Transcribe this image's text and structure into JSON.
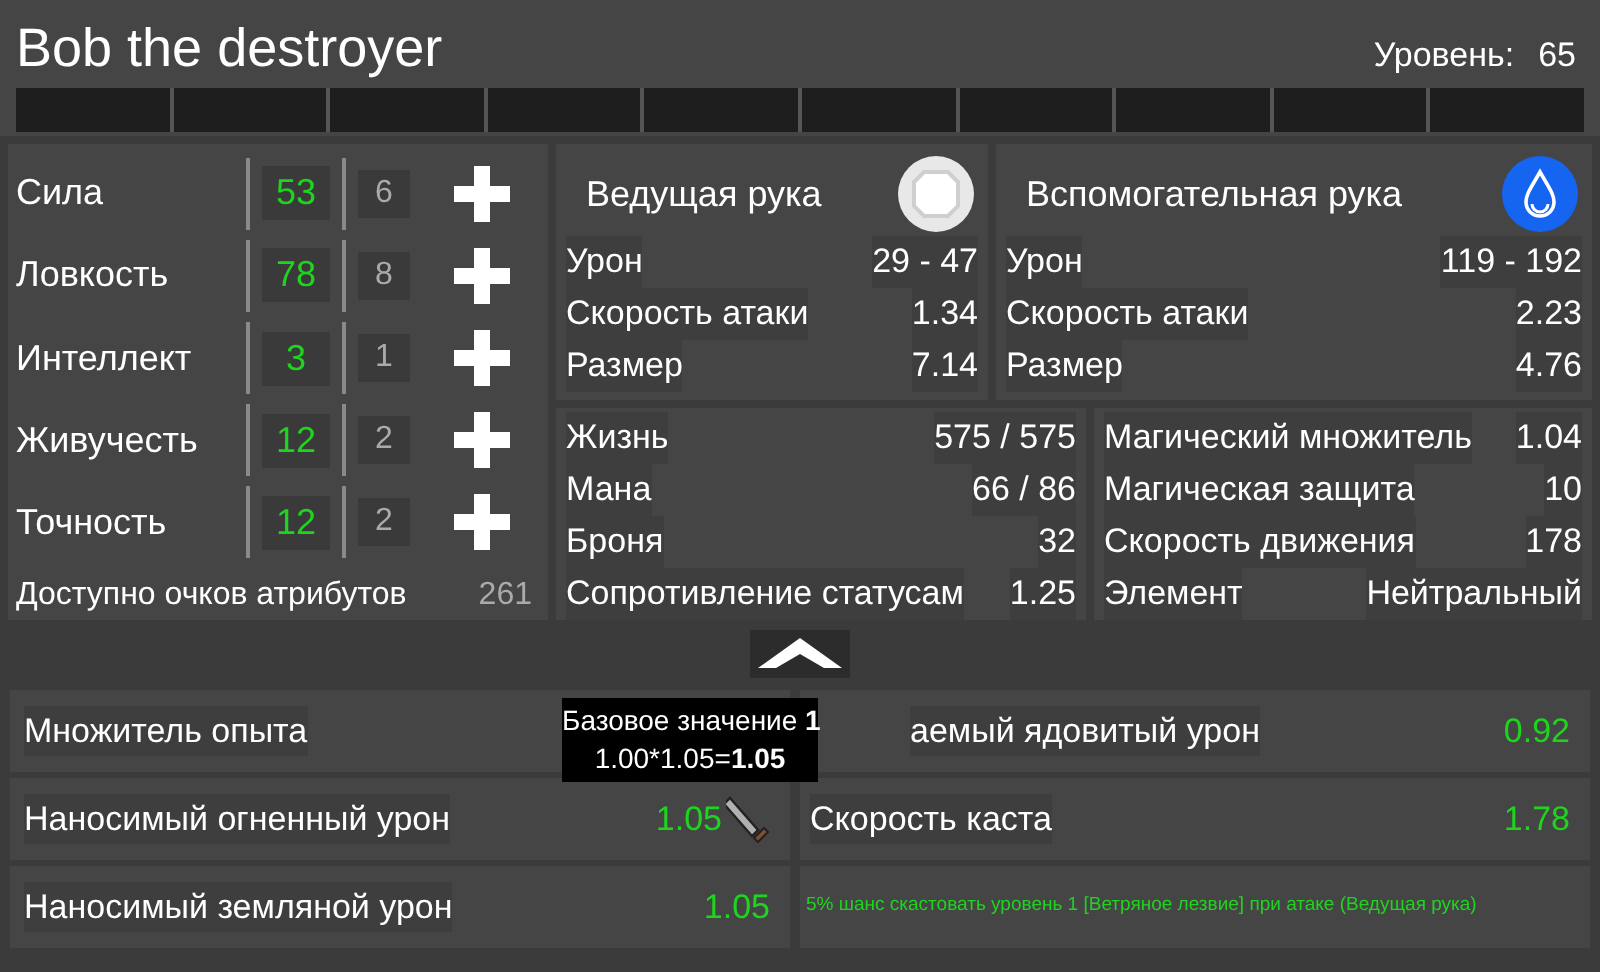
{
  "header": {
    "title": "Bob the destroyer",
    "level_label": "Уровень:",
    "level_value": "65"
  },
  "attributes": [
    {
      "name": "Сила",
      "value": "53",
      "points": "6"
    },
    {
      "name": "Ловкость",
      "value": "78",
      "points": "8"
    },
    {
      "name": "Интеллект",
      "value": "3",
      "points": "1"
    },
    {
      "name": "Живучесть",
      "value": "12",
      "points": "2"
    },
    {
      "name": "Точность",
      "value": "12",
      "points": "2"
    }
  ],
  "available": {
    "label": "Доступно очков атрибутов",
    "value": "261"
  },
  "hands": [
    {
      "title": "Ведущая рука",
      "kind": "neutral",
      "stats": [
        {
          "label": "Урон",
          "value": "29 - 47"
        },
        {
          "label": "Скорость атаки",
          "value": "1.34"
        },
        {
          "label": "Размер",
          "value": "7.14"
        }
      ]
    },
    {
      "title": "Вспомогательная рука",
      "kind": "water",
      "stats": [
        {
          "label": "Урон",
          "value": "119 - 192"
        },
        {
          "label": "Скорость атаки",
          "value": "2.23"
        },
        {
          "label": "Размер",
          "value": "4.76"
        }
      ]
    }
  ],
  "stats_left": [
    {
      "label": "Жизнь",
      "value": "575 / 575"
    },
    {
      "label": "Мана",
      "value": "66 / 86"
    },
    {
      "label": "Броня",
      "value": "32"
    },
    {
      "label": "Сопротивление статусам",
      "value": "1.25"
    }
  ],
  "stats_right": [
    {
      "label": "Магический множитель",
      "value": "1.04"
    },
    {
      "label": "Магическая защита",
      "value": "10"
    },
    {
      "label": "Скорость движения",
      "value": "178"
    },
    {
      "label": "Элемент",
      "value": "Нейтральный"
    }
  ],
  "bonuses_left": [
    {
      "label": "Множитель опыта"
    },
    {
      "label": "Наносимый огненный урон",
      "value": "1.05"
    },
    {
      "label": "Наносимый земляной урон",
      "value": "1.05"
    }
  ],
  "bonuses_right": [
    {
      "kind": "stat",
      "label": "аемый ядовитый урон",
      "value": "0.92"
    },
    {
      "kind": "stat",
      "label": "Скорость каста",
      "value": "1.78"
    },
    {
      "kind": "effect",
      "label": "5% шанс скастовать уровень 1 [Ветряное лезвие] при атаке (Ведущая рука)"
    }
  ],
  "tooltip": {
    "lines": [
      "Базовое значение **1**",
      "1.00*1.05=**1.05**"
    ]
  }
}
